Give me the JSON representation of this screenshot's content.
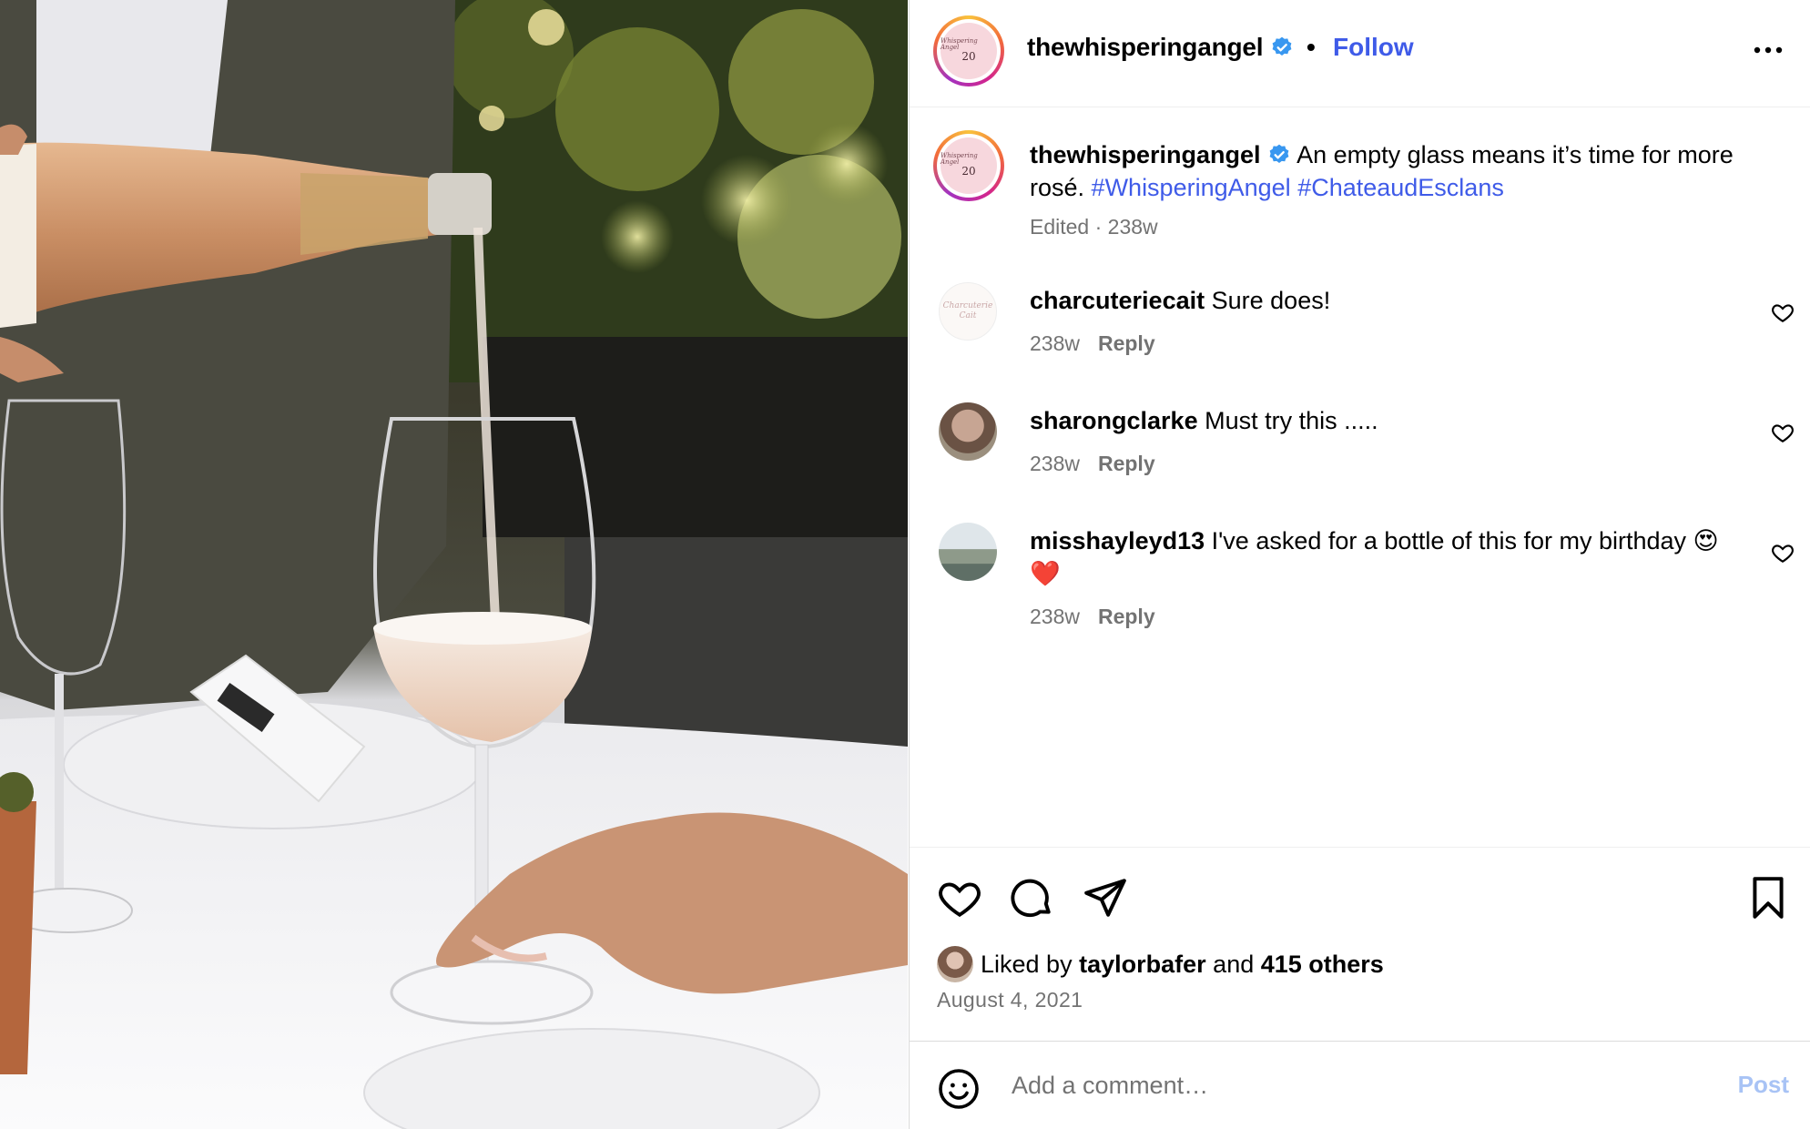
{
  "post": {
    "username": "thewhisperingangel",
    "follow_label": "Follow",
    "dot": "•",
    "avatar_script": "Whispering Angel",
    "avatar_number": "20",
    "caption_text": "An empty glass means it’s time for more rosé.",
    "hashtags": [
      "#WhisperingAngel",
      "#ChateaudEsclans"
    ],
    "meta": "Edited · 238w"
  },
  "comments": [
    {
      "username": "charcuteriecait",
      "text": "Sure does!",
      "age": "238w",
      "reply_label": "Reply",
      "avatar_script": "Charcuterie Cait"
    },
    {
      "username": "sharongclarke",
      "text": "Must try this .....",
      "age": "238w",
      "reply_label": "Reply"
    },
    {
      "username": "misshayleyd13",
      "text": "I've asked for a bottle of this for my birthday 😍❤️",
      "age": "238w",
      "reply_label": "Reply"
    }
  ],
  "likes": {
    "prefix": "Liked by",
    "user": "taylorbafer",
    "joiner": "and",
    "others": "415 others"
  },
  "date": "August 4, 2021",
  "add_comment": {
    "placeholder": "Add a comment…",
    "post_label": "Post"
  },
  "colors": {
    "link_blue": "#3f5be8",
    "post_disabled": "#a8c3f5",
    "meta_gray": "#737373",
    "verified_blue": "#3897f0"
  },
  "icons": [
    "more-options-icon",
    "verified-badge-icon",
    "heart-icon",
    "comment-icon",
    "share-icon",
    "bookmark-icon",
    "emoji-icon"
  ]
}
